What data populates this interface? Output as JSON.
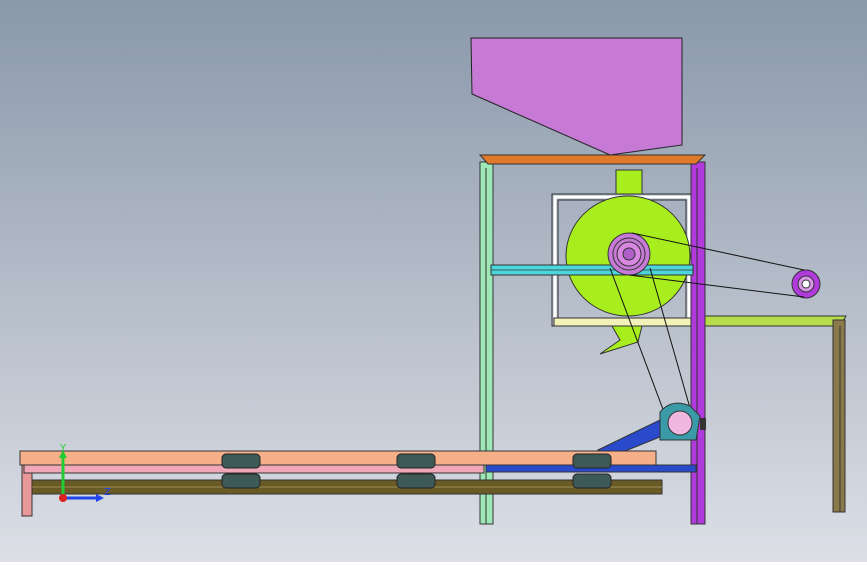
{
  "triad": {
    "y_label": "Y",
    "z_label": "Z"
  },
  "colors": {
    "bg_top": "#8a98aa",
    "bg_bottom": "#d8dce4",
    "hopper": "#c77bd6",
    "orange_beam": "#e07a2a",
    "cyan_beam": "#4ad6da",
    "green_post": "#9ee8b8",
    "magenta_post": "#b03adc",
    "drum": "#a8ee1e",
    "belt_salmon": "#f5b08a",
    "belt_pink": "#f0a8b8",
    "brown_rail": "#6a5a26",
    "olive_rail": "#b0d84a",
    "blue_link": "#2a4acc",
    "roller_dark": "#3e5a56"
  }
}
